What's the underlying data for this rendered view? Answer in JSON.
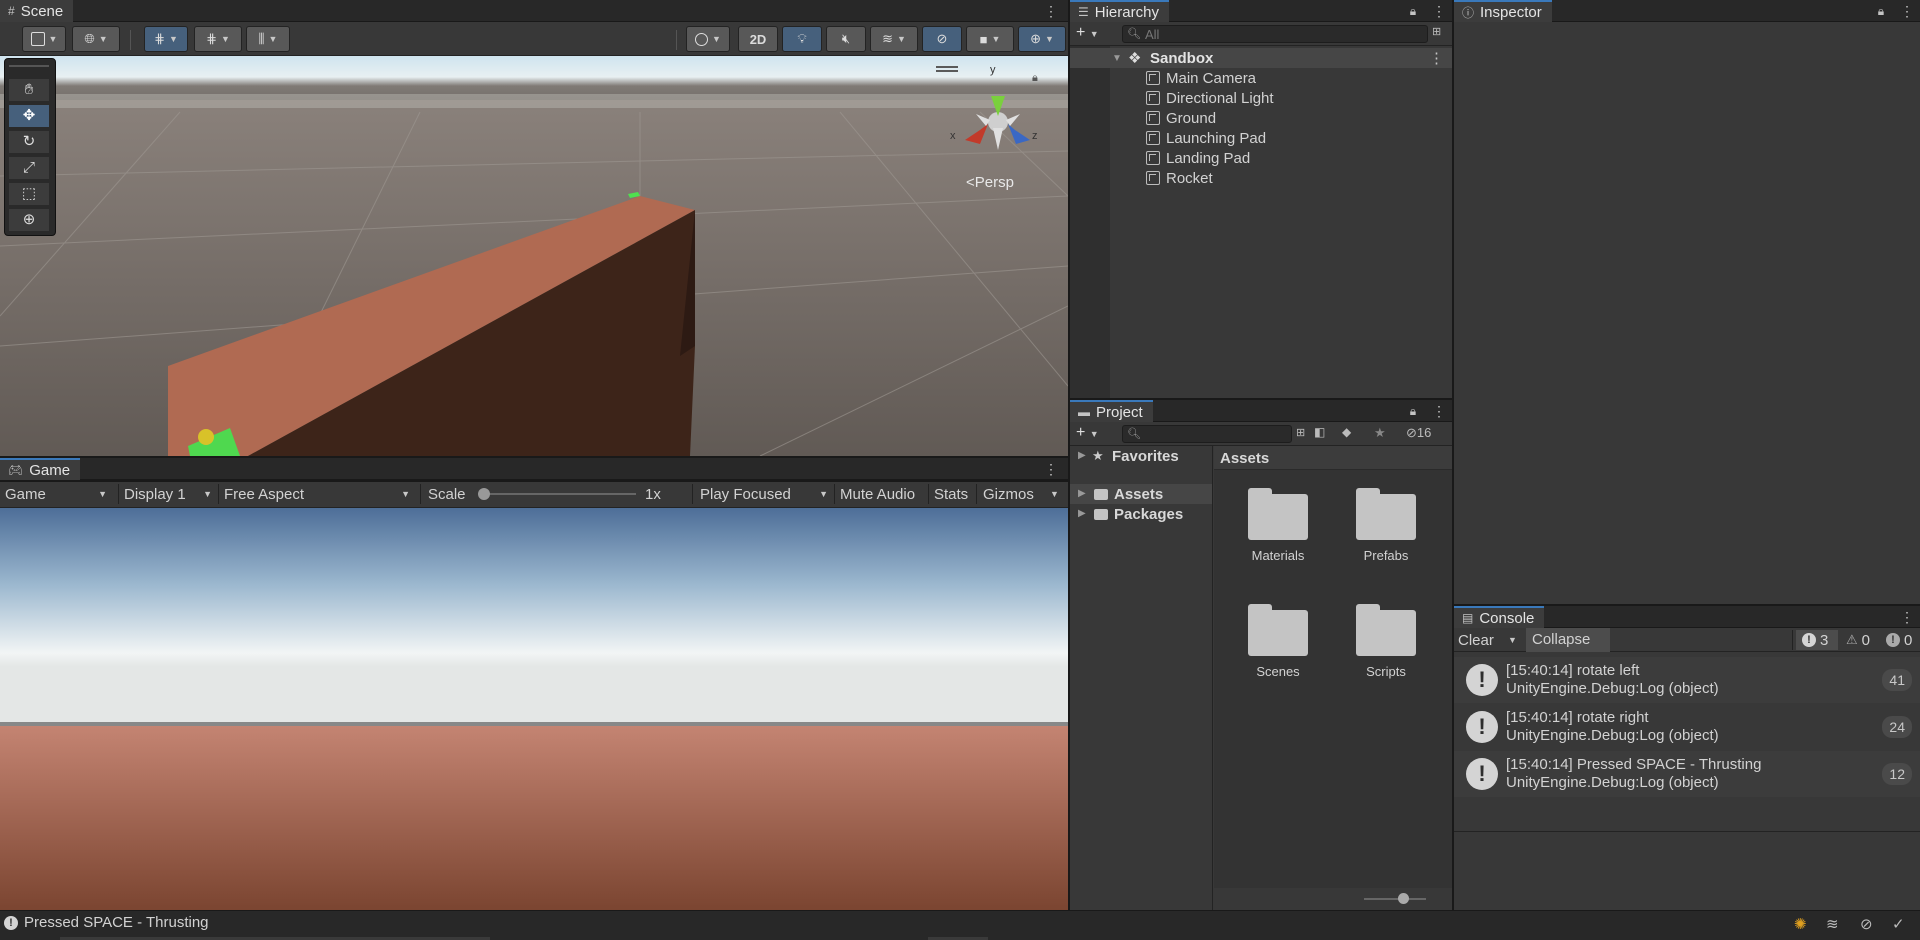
{
  "scene": {
    "tab_label": "Scene",
    "btn_2d": "2D",
    "persp_label": "Persp",
    "gizmo_y": "y",
    "gizmo_x": "x",
    "gizmo_z": "z"
  },
  "game": {
    "tab_label": "Game",
    "display_mode": "Game",
    "display": "Display 1",
    "aspect": "Free Aspect",
    "scale_label": "Scale",
    "scale_value": "1x",
    "play_mode": "Play Focused",
    "mute_label": "Mute Audio",
    "stats_label": "Stats",
    "gizmos_label": "Gizmos"
  },
  "hierarchy": {
    "tab_label": "Hierarchy",
    "search_placeholder": "All",
    "root": "Sandbox",
    "items": [
      "Main Camera",
      "Directional Light",
      "Ground",
      "Launching Pad",
      "Landing Pad",
      "Rocket"
    ]
  },
  "inspector": {
    "tab_label": "Inspector"
  },
  "project": {
    "tab_label": "Project",
    "hidden_count": "16",
    "favorites_label": "Favorites",
    "tree": [
      "Assets",
      "Packages"
    ],
    "breadcrumb": "Assets",
    "folders": [
      "Materials",
      "Prefabs",
      "Scenes",
      "Scripts"
    ]
  },
  "console": {
    "tab_label": "Console",
    "clear_label": "Clear",
    "collapse_label": "Collapse",
    "log_count": "3",
    "warn_count": "0",
    "error_count": "0",
    "entries": [
      {
        "line1": "[15:40:14] rotate left",
        "line2": "UnityEngine.Debug:Log (object)",
        "count": "41"
      },
      {
        "line1": "[15:40:14] rotate right",
        "line2": "UnityEngine.Debug:Log (object)",
        "count": "24"
      },
      {
        "line1": "[15:40:14] Pressed SPACE - Thrusting",
        "line2": "UnityEngine.Debug:Log (object)",
        "count": "12"
      }
    ]
  },
  "status": {
    "message": "Pressed SPACE - Thrusting"
  }
}
